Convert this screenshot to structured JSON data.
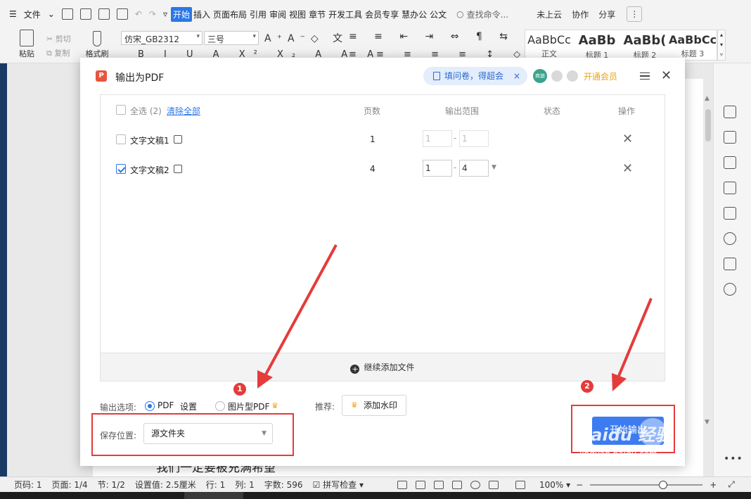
{
  "menubar": {
    "file": "文件",
    "tabs": [
      "开始",
      "插入",
      "页面布局",
      "引用",
      "审阅",
      "视图",
      "章节",
      "开发工具",
      "会员专享",
      "慧办公",
      "公文"
    ],
    "search": "查找命令...",
    "cloud": "未上云",
    "collab": "协作",
    "share": "分享"
  },
  "toolbar": {
    "paste": "粘贴",
    "cut": "剪切",
    "copy": "复制",
    "format_brush": "格式刷",
    "font_name": "仿宋_GB2312",
    "font_size": "三号",
    "styles": [
      {
        "sample": "AaBbCc",
        "label": "正文"
      },
      {
        "sample": "AaBb",
        "label": "标题 1"
      },
      {
        "sample": "AaBb(",
        "label": "标题 2"
      },
      {
        "sample": "AaBbCc",
        "label": "标题 3"
      }
    ]
  },
  "dialog": {
    "title": "输出为PDF",
    "promo": "填问卷，得超会",
    "avatar": "商旅",
    "vip": "开通会员",
    "list": {
      "select_all": "全选 (2)",
      "clear_all": "清除全部",
      "col_pages": "页数",
      "col_range": "输出范围",
      "col_status": "状态",
      "col_action": "操作",
      "rows": [
        {
          "name": "文字文稿1",
          "pages": "1",
          "from": "1",
          "to": "1",
          "checked": false
        },
        {
          "name": "文字文稿2",
          "pages": "4",
          "from": "1",
          "to": "4",
          "checked": true
        }
      ],
      "add_more": "继续添加文件"
    },
    "options": {
      "label": "输出选项:",
      "pdf": "PDF",
      "settings": "设置",
      "image_pdf": "图片型PDF",
      "recommend": "推荐:",
      "watermark": "添加水印"
    },
    "save": {
      "label": "保存位置:",
      "value": "源文件夹"
    },
    "start": "开始输出"
  },
  "annotations": {
    "badge1": "1",
    "badge2": "2"
  },
  "document": {
    "peek_text": "我们一定要被充满希望"
  },
  "statusbar": {
    "page_code": "页码: 1",
    "page": "页面: 1/4",
    "section": "节: 1/2",
    "setting": "设置值: 2.5厘米",
    "row": "行: 1",
    "col": "列: 1",
    "words": "字数: 596",
    "spell": "拼写检查",
    "zoom": "100%"
  },
  "watermark": {
    "brand": "Baidu 经验",
    "url": "jingyan.baidu.com"
  },
  "colors": {
    "accent": "#2a77e8",
    "annotation": "#e53b3b",
    "start_button": "#3d7cf0"
  }
}
